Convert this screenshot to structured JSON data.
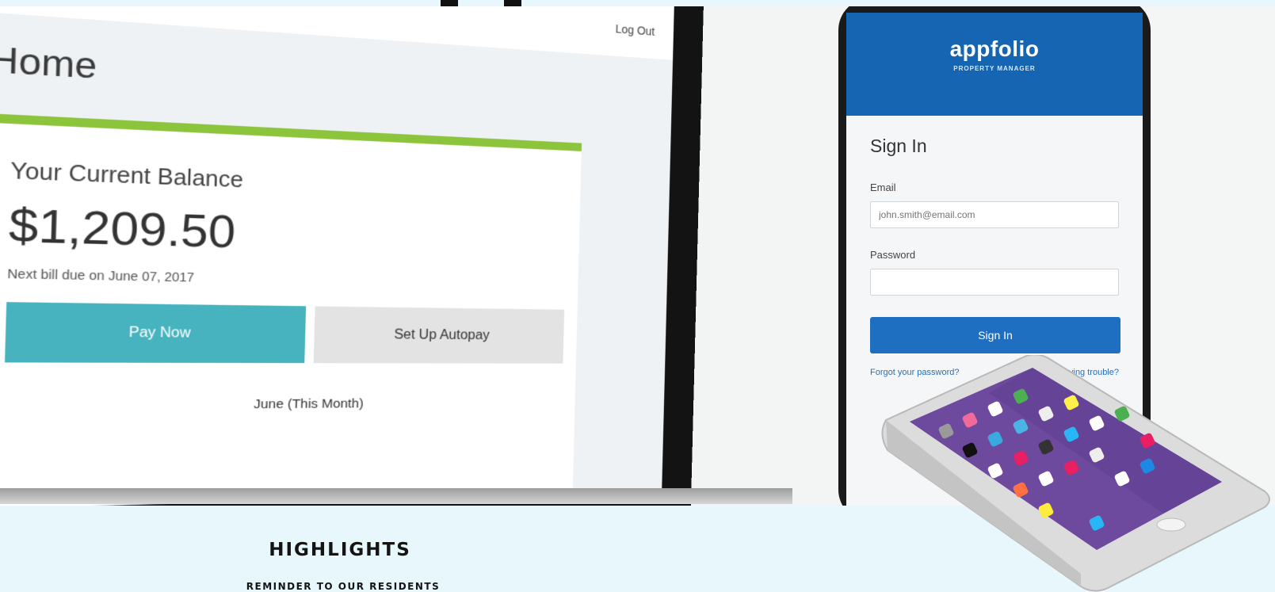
{
  "laptop": {
    "logout_label": "Log Out",
    "home_title": "Home",
    "balance_heading": "Your Current Balance",
    "balance_amount": "$1,209.50",
    "due_text": "Next bill due on June 07, 2017",
    "pay_now_label": "Pay Now",
    "autopay_label": "Set Up Autopay",
    "month_label": "June (This Month)",
    "accent_color": "#8cc43c",
    "pay_color": "#46b3be"
  },
  "phone": {
    "brand": "appfolio",
    "brand_sub": "PROPERTY MANAGER",
    "signin_title": "Sign In",
    "email_label": "Email",
    "email_placeholder": "john.smith@email.com",
    "password_label": "Password",
    "signin_button": "Sign In",
    "forgot_link": "Forgot your password?",
    "trouble_link": "Still having trouble?",
    "header_color": "#1565b3"
  },
  "section": {
    "heading": "HIGHLIGHTS",
    "subheading": "REMINDER TO OUR RESIDENTS"
  },
  "iso_phone_icons": [
    "settings-icon",
    "music-icon",
    "calendar-icon",
    "messages-icon",
    "maps-icon",
    "compass-icon",
    "camera-icon",
    "clock-icon",
    "weather-icon",
    "notes-icon",
    "stocks-icon",
    "reminders-icon",
    "photos-icon",
    "game-icon",
    "wallet-icon",
    "health-icon",
    "contacts-icon",
    "search-icon",
    "phone-icon",
    "facetime-icon"
  ]
}
